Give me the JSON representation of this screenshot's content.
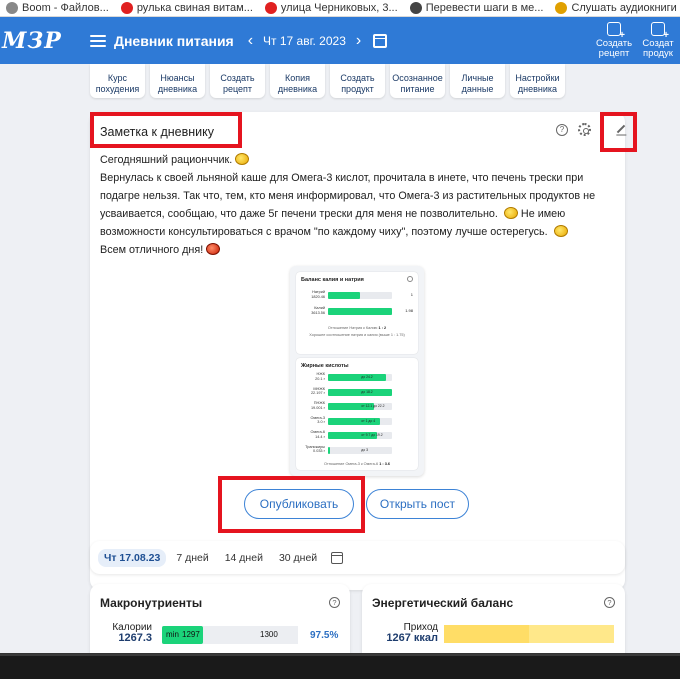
{
  "bookmarks": [
    {
      "label": "Boom - Файлов...",
      "color": "#888888"
    },
    {
      "label": "рулька свиная витам...",
      "color": "#e02020"
    },
    {
      "label": "улица Черниковых, 3...",
      "color": "#e02020"
    },
    {
      "label": "Перевести шаги в ме...",
      "color": "#444444"
    },
    {
      "label": "Слушать аудиокниги ...",
      "color": "#e0a000"
    }
  ],
  "header": {
    "logo": "МЗР",
    "title": "Дневник питания",
    "prev": "‹",
    "date": "Чт 17 авг. 2023",
    "next": "›",
    "actions": [
      {
        "line1": "Создать",
        "line2": "рецепт"
      },
      {
        "line1": "Создат",
        "line2": "продук"
      }
    ]
  },
  "shortcuts": [
    {
      "line1": "Курс",
      "line2": "похудения"
    },
    {
      "line1": "Нюансы",
      "line2": "дневника"
    },
    {
      "line1": "Создать",
      "line2": "рецепт"
    },
    {
      "line1": "Копия",
      "line2": "дневника"
    },
    {
      "line1": "Создать",
      "line2": "продукт"
    },
    {
      "line1": "Осознанное",
      "line2": "питание"
    },
    {
      "line1": "Личные",
      "line2": "данные"
    },
    {
      "line1": "Настройки",
      "line2": "дневника"
    }
  ],
  "note": {
    "title": "Заметка к дневнику",
    "line1": "Сегодняшний рационччик.",
    "line2": "Вернулась к своей льняной каше для Омега-3 кислот, прочитала в инете, что печень трески при подагре нельзя. Так что, тем, кто меня информировал, что Омега-3 из растительных продуктов не усваивается, сообщаю, что даже 5г печени трески для меня не позволительно.",
    "line2b": "Не имею возможности консультироваться с врачом \"по каждому чиху\", поэтому лучше остерегусь.",
    "line3": "Всем отличного дня!",
    "publish": "Опубликовать",
    "open_post": "Открыть пост"
  },
  "preview": {
    "card1": {
      "title": "Баланс калия и натрия",
      "rows": [
        {
          "name": "Натрий",
          "value": "1820.46",
          "fill": 0.5,
          "right": "1"
        },
        {
          "name": "Калий",
          "value": "3613.56",
          "fill": 1.0,
          "right": "1.98"
        }
      ],
      "ratio_label": "Отношение Натрия к Калию",
      "ratio_value": "1 : 2",
      "hint": "Хорошее соотношение натрия и калия (выше 1 : 1.75)"
    },
    "card2": {
      "title": "Жирные кислоты",
      "rows": [
        {
          "name": "НЖК",
          "value": "20.1 г",
          "fill": 0.9,
          "mark": "до 24.2"
        },
        {
          "name": "МНЖК",
          "value": "22.197 г",
          "fill": 1.0,
          "mark": "до 18.2"
        },
        {
          "name": "ПНЖК",
          "value": "19.001 г",
          "fill": 0.72,
          "mark": "от 12.1 до 22.2"
        },
        {
          "name": "Омега-3",
          "value": "3.0 г",
          "fill": 0.82,
          "mark": "от 1 до 4"
        },
        {
          "name": "Омега-6",
          "value": "14.4 г",
          "fill": 0.76,
          "mark": "от 9.7 до 19.2"
        },
        {
          "name": "Трансжиры",
          "value": "0.033 г",
          "fill": 0.03,
          "mark": "до 3"
        }
      ],
      "ratio_label": "Отношение Омега-3 к Омега-6",
      "ratio_value": "1 : 3.6"
    }
  },
  "periods": {
    "items": [
      "Чт 17.08.23",
      "7 дней",
      "14 дней",
      "30 дней"
    ]
  },
  "macro": {
    "title": "Макронутриенты",
    "label": "Калории",
    "value": "1267.3",
    "min_label": "min",
    "target": "1297",
    "max": "1300",
    "percent": "97.5%",
    "fill": 0.3
  },
  "energy": {
    "title": "Энергетический баланс",
    "label": "Приход",
    "value": "1267 ккал",
    "fill": 0.5
  },
  "colors": {
    "brand": "#2f7ad6",
    "highlight": "#e5141f",
    "green": "#1bd37a",
    "yellow": "#ffdd66"
  }
}
